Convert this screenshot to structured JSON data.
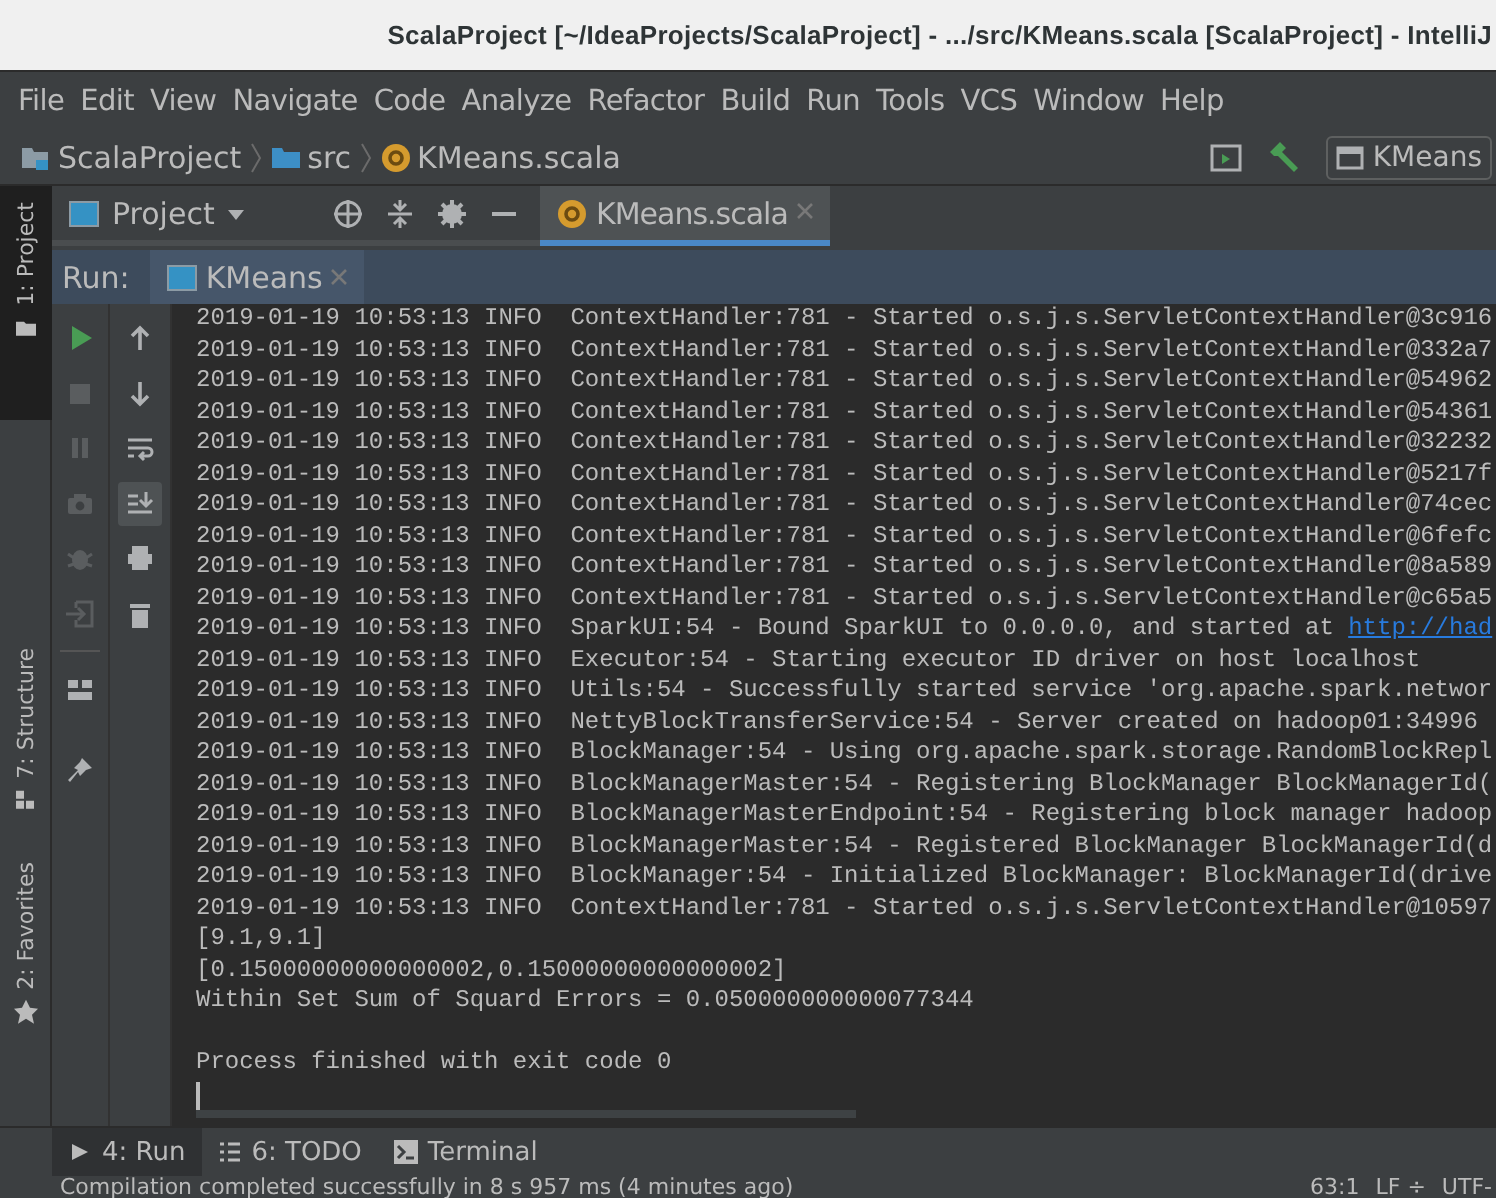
{
  "window": {
    "title": "ScalaProject [~/IdeaProjects/ScalaProject] - .../src/KMeans.scala [ScalaProject] - IntelliJ"
  },
  "menu": [
    "File",
    "Edit",
    "View",
    "Navigate",
    "Code",
    "Analyze",
    "Refactor",
    "Build",
    "Run",
    "Tools",
    "VCS",
    "Window",
    "Help"
  ],
  "breadcrumbs": [
    {
      "label": "ScalaProject",
      "kind": "project"
    },
    {
      "label": "src",
      "kind": "folder"
    },
    {
      "label": "KMeans.scala",
      "kind": "scala"
    }
  ],
  "run_config": {
    "label": "KMeans"
  },
  "side_tabs": [
    {
      "label": "1: Project",
      "kind": "project"
    },
    {
      "label": "7: Structure",
      "kind": "structure"
    },
    {
      "label": "2: Favorites",
      "kind": "favorites"
    }
  ],
  "tool_window": {
    "title": "Project"
  },
  "editor_tabs": [
    {
      "label": "KMeans.scala",
      "selected": true
    }
  ],
  "run": {
    "label": "Run:",
    "tabs": [
      {
        "label": "KMeans",
        "selected": true
      }
    ],
    "toolbar_1": [
      {
        "kind": "run",
        "disabled": false
      },
      {
        "kind": "stop",
        "disabled": true
      },
      {
        "kind": "pause",
        "disabled": true
      },
      {
        "kind": "camera",
        "disabled": true
      },
      {
        "kind": "bug",
        "disabled": true
      },
      {
        "kind": "exit",
        "disabled": true
      },
      {
        "kind": "layout",
        "disabled": false
      },
      {
        "kind": "pin",
        "disabled": false
      }
    ],
    "toolbar_2": [
      {
        "kind": "up",
        "selected": false
      },
      {
        "kind": "down",
        "selected": false
      },
      {
        "kind": "wrap",
        "selected": false
      },
      {
        "kind": "scroll-end",
        "selected": true
      },
      {
        "kind": "print",
        "selected": false
      },
      {
        "kind": "trash",
        "selected": false
      }
    ],
    "console": [
      {
        "text": "2019-01-19 10:53:13 INFO  ContextHandler:781 - Started o.s.j.s.ServletContextHandler@3c916"
      },
      {
        "text": "2019-01-19 10:53:13 INFO  ContextHandler:781 - Started o.s.j.s.ServletContextHandler@332a7"
      },
      {
        "text": "2019-01-19 10:53:13 INFO  ContextHandler:781 - Started o.s.j.s.ServletContextHandler@54962"
      },
      {
        "text": "2019-01-19 10:53:13 INFO  ContextHandler:781 - Started o.s.j.s.ServletContextHandler@54361"
      },
      {
        "text": "2019-01-19 10:53:13 INFO  ContextHandler:781 - Started o.s.j.s.ServletContextHandler@32232"
      },
      {
        "text": "2019-01-19 10:53:13 INFO  ContextHandler:781 - Started o.s.j.s.ServletContextHandler@5217f"
      },
      {
        "text": "2019-01-19 10:53:13 INFO  ContextHandler:781 - Started o.s.j.s.ServletContextHandler@74cec"
      },
      {
        "text": "2019-01-19 10:53:13 INFO  ContextHandler:781 - Started o.s.j.s.ServletContextHandler@6fefc"
      },
      {
        "text": "2019-01-19 10:53:13 INFO  ContextHandler:781 - Started o.s.j.s.ServletContextHandler@8a589"
      },
      {
        "text": "2019-01-19 10:53:13 INFO  ContextHandler:781 - Started o.s.j.s.ServletContextHandler@c65a5"
      },
      {
        "text": "2019-01-19 10:53:13 INFO  SparkUI:54 - Bound SparkUI to 0.0.0.0, and started at ",
        "link": "http://had"
      },
      {
        "text": "2019-01-19 10:53:13 INFO  Executor:54 - Starting executor ID driver on host localhost"
      },
      {
        "text": "2019-01-19 10:53:13 INFO  Utils:54 - Successfully started service 'org.apache.spark.networ"
      },
      {
        "text": "2019-01-19 10:53:13 INFO  NettyBlockTransferService:54 - Server created on hadoop01:34996"
      },
      {
        "text": "2019-01-19 10:53:13 INFO  BlockManager:54 - Using org.apache.spark.storage.RandomBlockRepl"
      },
      {
        "text": "2019-01-19 10:53:13 INFO  BlockManagerMaster:54 - Registering BlockManager BlockManagerId("
      },
      {
        "text": "2019-01-19 10:53:13 INFO  BlockManagerMasterEndpoint:54 - Registering block manager hadoop"
      },
      {
        "text": "2019-01-19 10:53:13 INFO  BlockManagerMaster:54 - Registered BlockManager BlockManagerId(d"
      },
      {
        "text": "2019-01-19 10:53:13 INFO  BlockManager:54 - Initialized BlockManager: BlockManagerId(drive"
      },
      {
        "text": "2019-01-19 10:53:13 INFO  ContextHandler:781 - Started o.s.j.s.ServletContextHandler@10597"
      },
      {
        "text": "[9.1,9.1]"
      },
      {
        "text": "[0.15000000000000002,0.15000000000000002]"
      },
      {
        "text": "Within Set Sum of Squard Errors = 0.050000000000077344"
      },
      {
        "text": "Process finished with exit code 0"
      }
    ]
  },
  "bottom_tabs": [
    {
      "label": "4: Run",
      "kind": "run",
      "selected": true
    },
    {
      "label": "6: TODO",
      "kind": "todo",
      "selected": false
    },
    {
      "label": "Terminal",
      "kind": "terminal",
      "selected": false
    }
  ],
  "status_bar": {
    "message": "Compilation completed successfully in 8 s 957 ms (4 minutes ago)",
    "position": "63:1",
    "line_separator": "LF ÷",
    "encoding": "UTF-"
  }
}
